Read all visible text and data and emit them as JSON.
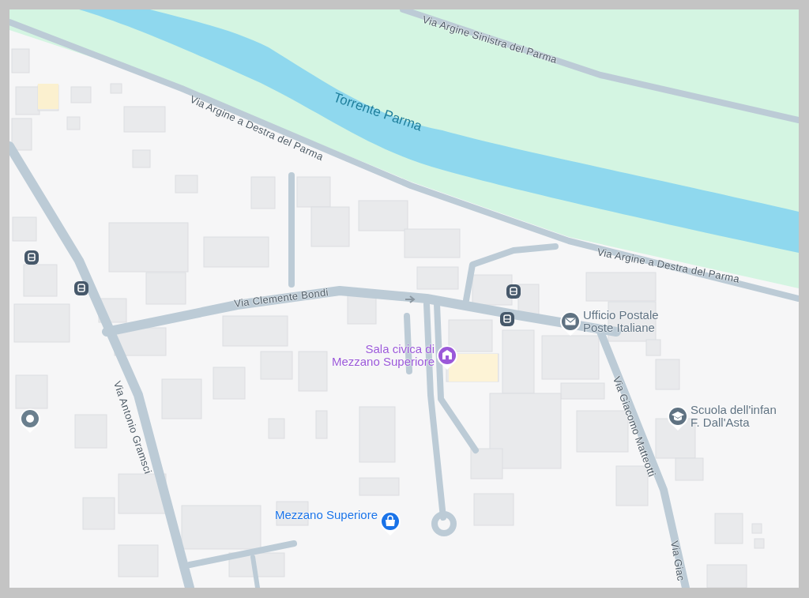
{
  "map": {
    "water_label": "Torrente Parma",
    "street_labels": [
      "Via Argine Sinistra del Parma",
      "Via Argine a Destra del Parma",
      "Via Argine a Destra del Parma",
      "Via Clemente Bondi",
      "Via Antonio Gramsci",
      "Via Giacomo Matteotti",
      "Via Giac"
    ],
    "places": [
      {
        "kind": "civic",
        "lines": [
          "Sala civica di",
          "Mezzano Superiore"
        ],
        "color": "#9b59d9"
      },
      {
        "kind": "post",
        "lines": [
          "Ufficio Postale",
          "Poste Italiane"
        ],
        "color": "#5f7282"
      },
      {
        "kind": "school",
        "lines": [
          "Scuola dell'infan",
          "F. Dall'Asta"
        ],
        "color": "#5f7282"
      },
      {
        "kind": "shop",
        "lines": [
          "Mezzano Superiore"
        ],
        "color": "#1a73e8"
      }
    ]
  }
}
